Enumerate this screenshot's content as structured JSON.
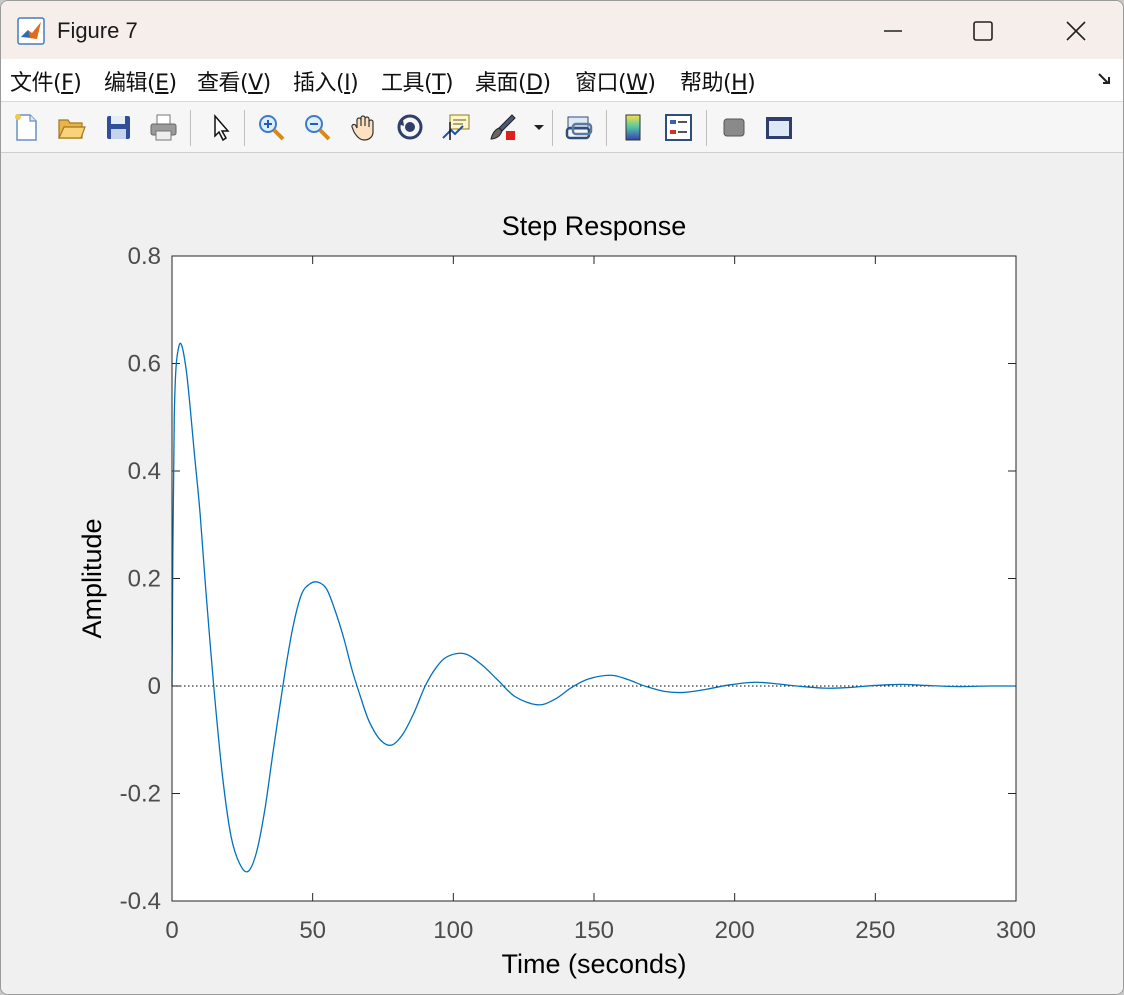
{
  "window": {
    "title": "Figure 7"
  },
  "menu": [
    {
      "pre": "文件(",
      "key": "F",
      "post": ")"
    },
    {
      "pre": "编辑(",
      "key": "E",
      "post": ")"
    },
    {
      "pre": "查看(",
      "key": "V",
      "post": ")"
    },
    {
      "pre": "插入(",
      "key": "I",
      "post": ")"
    },
    {
      "pre": "工具(",
      "key": "T",
      "post": ")"
    },
    {
      "pre": "桌面(",
      "key": "D",
      "post": ")"
    },
    {
      "pre": "窗口(",
      "key": "W",
      "post": ")"
    },
    {
      "pre": "帮助(",
      "key": "H",
      "post": ")"
    }
  ],
  "toolbar_icons": [
    "new-figure-icon",
    "open-file-icon",
    "save-icon",
    "print-icon",
    "pointer-icon",
    "zoom-in-icon",
    "zoom-out-icon",
    "pan-hand-icon",
    "rotate-3d-icon",
    "data-cursor-icon",
    "brush-icon",
    "brush-dropdown-icon",
    "link-plot-icon",
    "colorbar-icon",
    "legend-icon",
    "hide-plot-tools-icon",
    "show-plot-tools-icon"
  ],
  "colors": {
    "line": "#0072bd",
    "axes": "#262626",
    "tick_text": "#4d4d4d"
  },
  "chart_data": {
    "type": "line",
    "title": "Step Response",
    "xlabel": "Time (seconds)",
    "ylabel": "Amplitude",
    "xlim": [
      0,
      300
    ],
    "ylim": [
      -0.4,
      0.8
    ],
    "xticks": [
      0,
      50,
      100,
      150,
      200,
      250,
      300
    ],
    "yticks": [
      -0.4,
      -0.2,
      0,
      0.2,
      0.4,
      0.6,
      0.8
    ],
    "ytick_labels": [
      "-0.4",
      "-0.2",
      "0",
      "0.2",
      "0.4",
      "0.6",
      "0.8"
    ],
    "reference_line": 0,
    "grid": false,
    "series": [
      {
        "x": [
          0,
          0.8,
          2.5,
          5,
          8,
          10,
          12,
          15,
          18,
          21,
          24,
          27,
          30,
          33,
          36,
          40,
          43,
          46,
          49,
          52,
          55,
          58,
          61,
          64,
          67,
          70,
          74,
          78,
          82,
          86,
          90,
          94,
          98,
          104,
          110,
          116,
          122,
          130,
          136,
          142,
          148,
          156,
          162,
          168,
          175,
          182,
          190,
          198,
          207,
          215,
          222,
          232,
          240,
          250,
          259,
          268,
          280,
          290,
          300
        ],
        "y": [
          0,
          0.5,
          0.633,
          0.59,
          0.43,
          0.32,
          0.18,
          -0.01,
          -0.17,
          -0.28,
          -0.33,
          -0.345,
          -0.31,
          -0.23,
          -0.12,
          0.02,
          0.11,
          0.17,
          0.19,
          0.193,
          0.18,
          0.14,
          0.09,
          0.03,
          -0.02,
          -0.065,
          -0.1,
          -0.11,
          -0.09,
          -0.05,
          0.0,
          0.035,
          0.055,
          0.06,
          0.04,
          0.01,
          -0.02,
          -0.035,
          -0.025,
          -0.003,
          0.013,
          0.02,
          0.012,
          0.0,
          -0.01,
          -0.012,
          -0.006,
          0.002,
          0.007,
          0.004,
          0.0,
          -0.004,
          -0.003,
          0.001,
          0.003,
          0.001,
          -0.001,
          0.0,
          0.0
        ]
      }
    ]
  }
}
